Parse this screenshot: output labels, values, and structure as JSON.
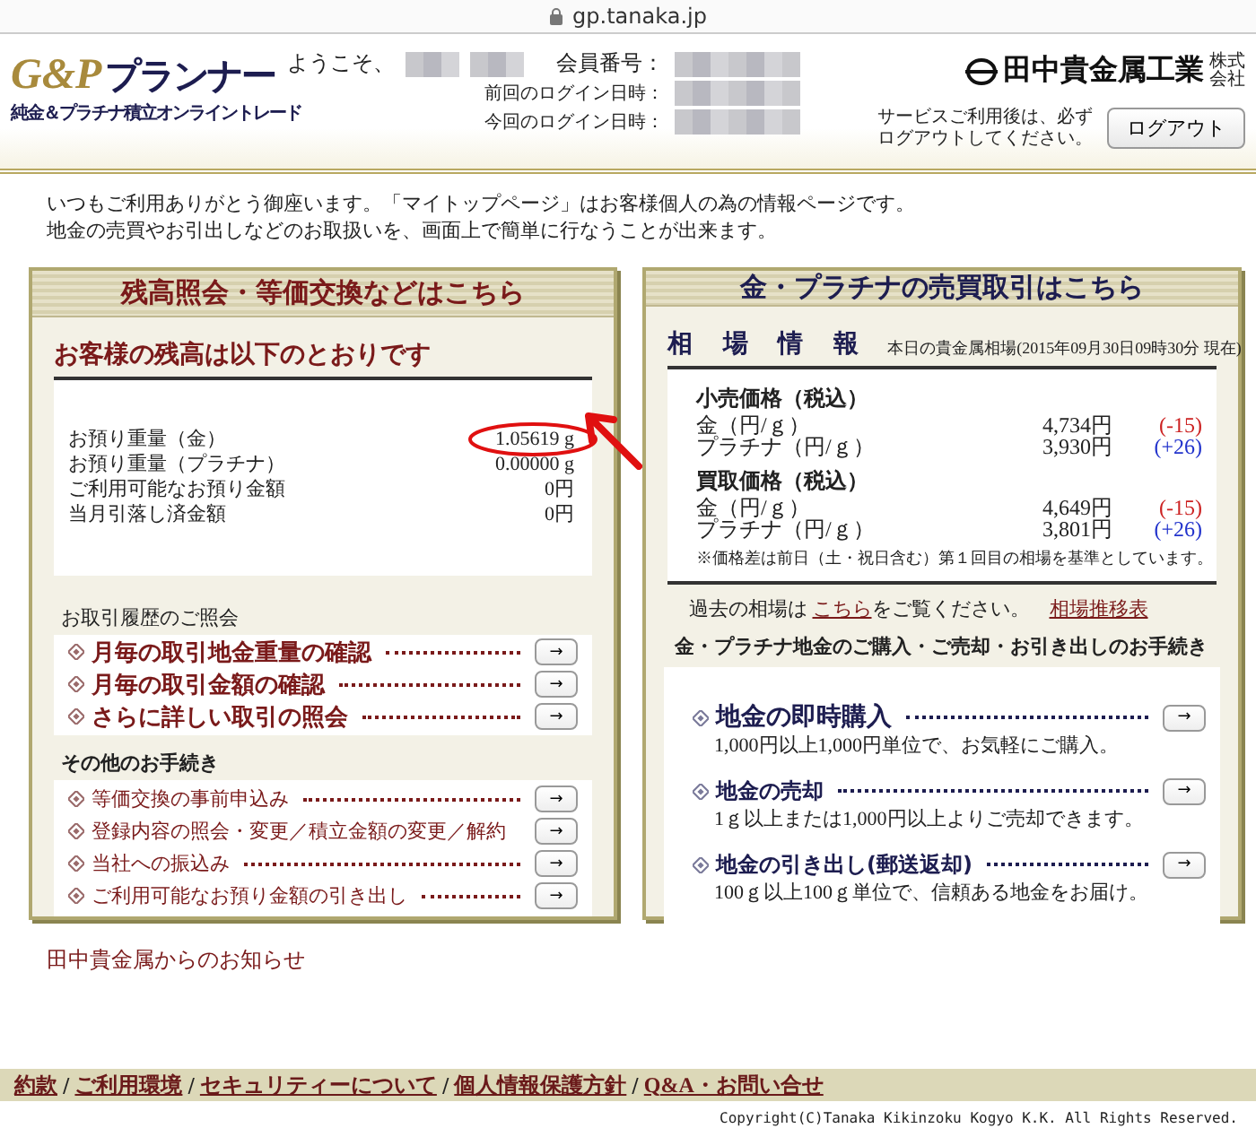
{
  "browser": {
    "url": "gp.tanaka.jp"
  },
  "header": {
    "logo_mark": "G&P",
    "logo_text": "プランナー",
    "logo_tagline": "純金＆プラチナ積立オンライントレード",
    "welcome": "ようこそ、",
    "member_label": "会員番号：",
    "last_login_label": "前回のログイン日時：",
    "current_login_label": "今回のログイン日時：",
    "company": "田中貴金属工業",
    "company_suffix": "株式会社",
    "logout_note": "サービスご利用後は、必ずログアウトしてください。",
    "logout_button": "ログアウト"
  },
  "intro": [
    "いつもご利用ありがとう御座います。「マイトップページ」はお客様個人の為の情報ページです。",
    "地金の売買やお引出しなどのお取扱いを、画面上で簡単に行なうことが出来ます。"
  ],
  "left_panel": {
    "title": "残高照会・等価交換などはこちら",
    "balance": {
      "heading": "お客様の残高は以下のとおりです",
      "rows": [
        {
          "label": "お預り重量（金）",
          "value": "1.05619 g",
          "circled": true
        },
        {
          "label": "お預り重量（プラチナ）",
          "value": "0.00000 g",
          "circled": false
        },
        {
          "label": "ご利用可能なお預り金額",
          "value": "0円",
          "circled": false
        },
        {
          "label": "当月引落し済金額",
          "value": "0円",
          "circled": false
        }
      ]
    },
    "history": {
      "heading": "お取引履歴のご照会",
      "links": [
        {
          "label": "月毎の取引地金重量の確認",
          "button": "→"
        },
        {
          "label": "月毎の取引金額の確認",
          "button": "→"
        },
        {
          "label": "さらに詳しい取引の照会",
          "button": "→"
        }
      ]
    },
    "other": {
      "heading": "その他のお手続き",
      "links": [
        {
          "label": "等価交換の事前申込み",
          "button": "→"
        },
        {
          "label": "登録内容の照会・変更／積立金額の変更／解約",
          "button": "→"
        },
        {
          "label": "当社への振込み",
          "button": "→"
        },
        {
          "label": "ご利用可能なお預り金額の引き出し",
          "button": "→"
        }
      ]
    }
  },
  "right_panel": {
    "title": "金・プラチナの売買取引はこちら",
    "market": {
      "heading": "相 場 情 報",
      "note": "本日の貴金属相場(2015年09月30日09時30分 現在)",
      "groups": [
        {
          "title": "小売価格（税込）",
          "rows": [
            {
              "label": "金（円/ｇ）",
              "price": "4,734円",
              "change": "(-15)",
              "color": "#cc2222"
            },
            {
              "label": "プラチナ（円/ｇ）",
              "price": "3,930円",
              "change": "(+26)",
              "color": "#2233cc"
            }
          ]
        },
        {
          "title": "買取価格（税込）",
          "rows": [
            {
              "label": "金（円/ｇ）",
              "price": "4,649円",
              "change": "(-15)",
              "color": "#cc2222"
            },
            {
              "label": "プラチナ（円/ｇ）",
              "price": "3,801円",
              "change": "(+26)",
              "color": "#2233cc"
            }
          ]
        }
      ],
      "footnote": "※価格差は前日（土・祝日含む）第１回目の相場を基準としています。"
    },
    "past": {
      "prefix": "過去の相場は",
      "link": "こちら",
      "suffix": "をご覧ください。",
      "chart_link": "相場推移表"
    },
    "procedures": {
      "heading": "金・プラチナ地金のご購入・ご売却・お引き出しのお手続き",
      "items": [
        {
          "title": "地金の即時購入",
          "desc": "1,000円以上1,000円単位で、お気軽にご購入。",
          "button": "→",
          "large": true
        },
        {
          "title": "地金の売却",
          "desc": "1ｇ以上または1,000円以上よりご売却できます。",
          "button": "→",
          "large": false
        },
        {
          "title": "地金の引き出し(郵送返却)",
          "desc": "100ｇ以上100ｇ単位で、信頼ある地金をお届け。",
          "button": "→",
          "large": false
        }
      ]
    }
  },
  "notice_heading": "田中貴金属からのお知らせ",
  "footer": {
    "links": [
      "約款",
      "ご利用環境",
      "セキュリティーについて",
      "個人情報保護方針",
      "Q&A・お問い合せ"
    ],
    "separators": [
      "/",
      "/",
      "/",
      "/"
    ],
    "copyright": "Copyright(C)Tanaka Kikinzoku Kogyo K.K. All Rights Reserved."
  }
}
